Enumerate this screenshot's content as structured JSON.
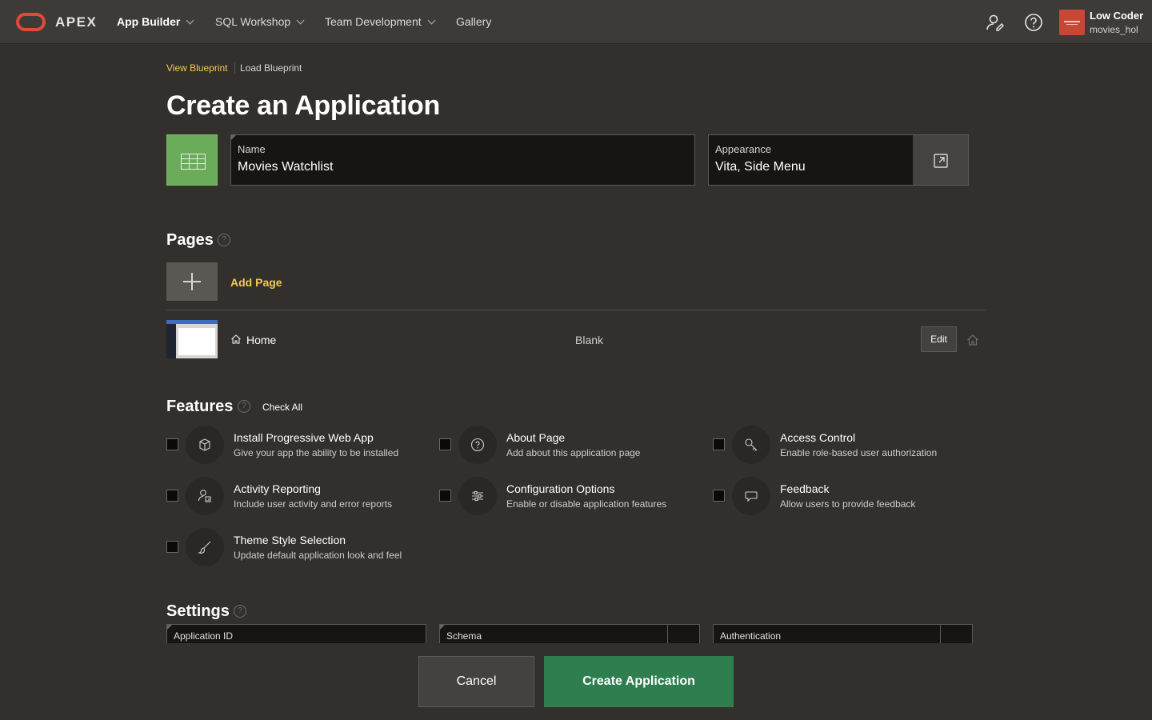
{
  "header": {
    "logo_text": "APEX",
    "nav": [
      {
        "label": "App Builder",
        "active": true
      },
      {
        "label": "SQL Workshop"
      },
      {
        "label": "Team Development"
      },
      {
        "label": "Gallery"
      }
    ],
    "user": {
      "name": "Low Coder",
      "workspace": "movies_hol"
    },
    "icons": [
      "administration-icon",
      "help-icon"
    ]
  },
  "breadcrumb": {
    "link": "View Blueprint",
    "current": "Load Blueprint"
  },
  "title": "Create an Application",
  "name_field": {
    "label": "Name",
    "value": "Movies Watchlist"
  },
  "appearance_field": {
    "label": "Appearance",
    "value": "Vita, Side Menu"
  },
  "pages": {
    "heading": "Pages",
    "add_label": "Add Page",
    "rows": [
      {
        "name": "Home",
        "type": "Blank",
        "edit_label": "Edit"
      }
    ]
  },
  "features": {
    "heading": "Features",
    "check_all": "Check All",
    "items": [
      {
        "title": "Install Progressive Web App",
        "desc": "Give your app the ability to be installed",
        "icon": "package-icon",
        "checked": false
      },
      {
        "title": "About Page",
        "desc": "Add about this application page",
        "icon": "question-circle-icon",
        "checked": false
      },
      {
        "title": "Access Control",
        "desc": "Enable role-based user authorization",
        "icon": "key-icon",
        "checked": false
      },
      {
        "title": "Activity Reporting",
        "desc": "Include user activity and error reports",
        "icon": "user-chart-icon",
        "checked": false
      },
      {
        "title": "Configuration Options",
        "desc": "Enable or disable application features",
        "icon": "sliders-icon",
        "checked": false
      },
      {
        "title": "Feedback",
        "desc": "Allow users to provide feedback",
        "icon": "comment-icon",
        "checked": false
      },
      {
        "title": "Theme Style Selection",
        "desc": "Update default application look and feel",
        "icon": "brush-icon",
        "checked": false
      }
    ]
  },
  "settings": {
    "heading": "Settings",
    "fields": [
      {
        "label": "Application ID"
      },
      {
        "label": "Schema"
      },
      {
        "label": "Authentication"
      }
    ]
  },
  "footer": {
    "cancel_label": "Cancel",
    "create_label": "Create Application"
  },
  "colors": {
    "accent": "#f0cc4d",
    "primary_button": "#2f7e4f",
    "brand": "#c74634",
    "background": "#322f2d"
  }
}
